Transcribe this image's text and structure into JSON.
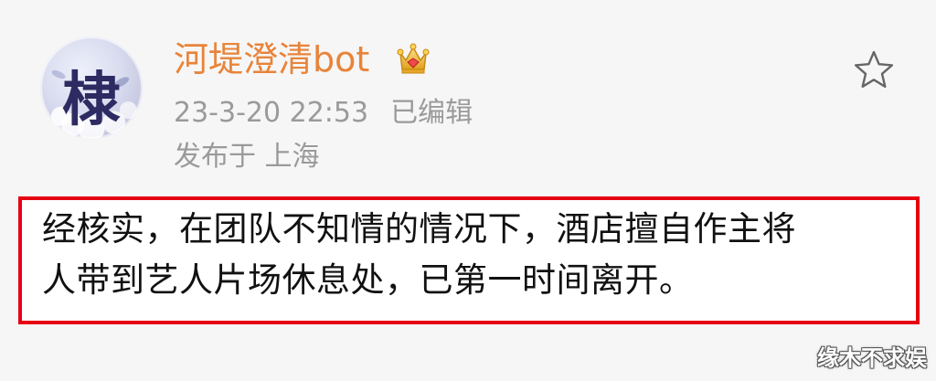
{
  "post": {
    "username": "河堤澄清bot",
    "avatar_glyph": "棣",
    "timestamp": "23-3-20 22:53",
    "edited_label": "已编辑",
    "location": "发布于 上海",
    "content_line1": "经核实，在团队不知情的情况下，酒店擅自作主将",
    "content_line2": "人带到艺人片场休息处，已第一时间离开。"
  },
  "icons": {
    "badge": "crown-badge-icon",
    "favorite": "star-outline-icon"
  },
  "watermark": "缘木不求娱",
  "colors": {
    "username": "#e8843a",
    "highlight_border": "#e60012",
    "meta_text": "#9a9a9a"
  }
}
